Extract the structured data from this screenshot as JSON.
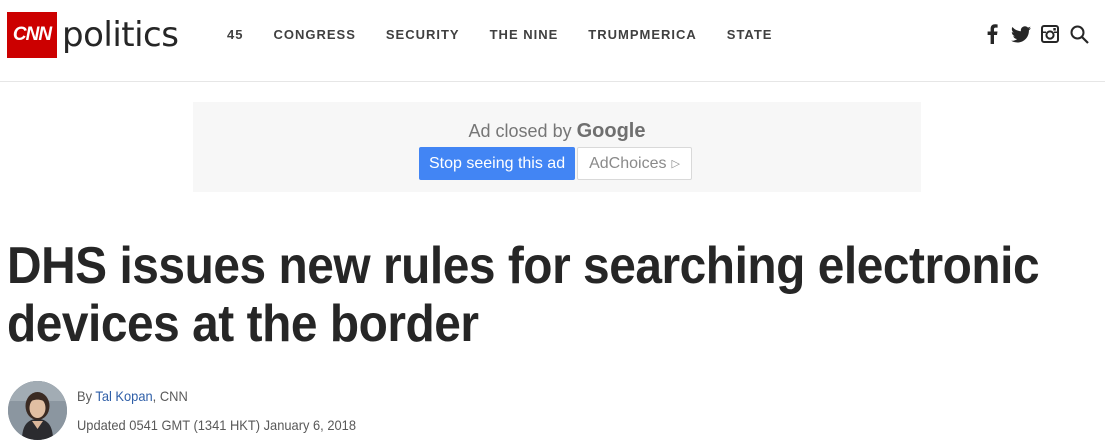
{
  "header": {
    "logo_text": "CNN",
    "section_name": "politics",
    "nav": [
      "45",
      "CONGRESS",
      "SECURITY",
      "THE NINE",
      "TRUMPMERICA",
      "STATE"
    ],
    "icons": [
      "facebook-icon",
      "twitter-icon",
      "instagram-icon",
      "search-icon"
    ]
  },
  "ad": {
    "closed_prefix": "Ad closed by ",
    "closed_brand": "Google",
    "stop_label": "Stop seeing this ad",
    "adchoices_label": "AdChoices",
    "adchoices_icon": "▷"
  },
  "article": {
    "headline_line1": "DHS issues new rules for searching electronic",
    "headline_line2": "devices at the border",
    "byline_prefix": "By ",
    "author": "Tal Kopan",
    "byline_suffix": ", CNN",
    "updated": "Updated 0541 GMT (1341 HKT) January 6, 2018"
  },
  "colors": {
    "brand_red": "#cc0000",
    "ad_button_blue": "#4285f4",
    "link_blue": "#2f5fa8"
  }
}
